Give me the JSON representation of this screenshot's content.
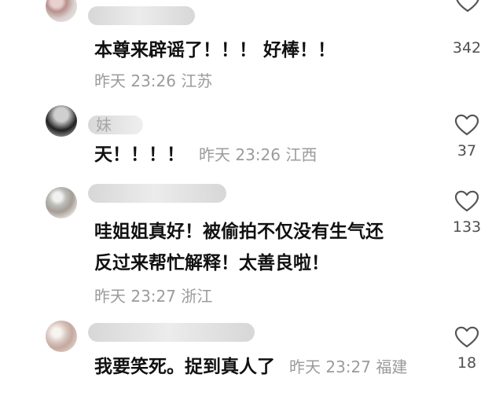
{
  "comments": [
    {
      "username": "",
      "text": "本尊来辟谣了！！！ 好棒！！",
      "time": "昨天 23:26 江苏",
      "likes": "342"
    },
    {
      "username": "妹",
      "text": "天！！！！",
      "time": "昨天 23:26 江西",
      "likes": "37"
    },
    {
      "username": "",
      "text_line1": "哇姐姐真好！被偷拍不仅没有生气还",
      "text_line2": "反过来帮忙解释！太善良啦！",
      "time": "昨天 23:27 浙江",
      "likes": "133"
    },
    {
      "username": "",
      "text": "我要笑死。捉到真人了",
      "time": "昨天 23:27 福建",
      "likes": "18"
    }
  ]
}
